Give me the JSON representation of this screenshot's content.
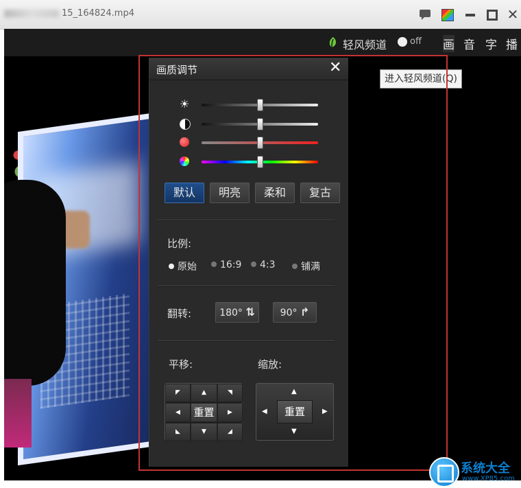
{
  "window": {
    "title": "15_164824.mp4"
  },
  "toolbar": {
    "channel_label": "轻风频道",
    "toggle_state": "off",
    "buttons": [
      "画",
      "音",
      "字",
      "播"
    ]
  },
  "tooltip": "进入轻风频道(Q)",
  "panel": {
    "title": "画质调节",
    "close_label": "✕",
    "sliders": [
      {
        "name": "brightness",
        "icon": "sun-icon",
        "level": 0.5
      },
      {
        "name": "contrast",
        "icon": "contrast-icon",
        "level": 0.5
      },
      {
        "name": "saturation",
        "icon": "red-dot-icon",
        "level": 0.5
      },
      {
        "name": "hue",
        "icon": "color-wheel-icon",
        "level": 0.5
      }
    ],
    "presets": [
      "默认",
      "明亮",
      "柔和",
      "复古"
    ],
    "active_preset": "默认",
    "ratio_label": "比例:",
    "ratio_options": [
      "原始",
      "16:9",
      "4:3",
      "铺满"
    ],
    "ratio_selected": "原始",
    "flip_label": "翻转:",
    "flip_buttons": [
      "180°",
      "90°"
    ],
    "pan_label": "平移:",
    "zoom_label": "缩放:",
    "pan_reset": "重置",
    "zoom_reset": "重置"
  },
  "watermark": {
    "text": "系统大全",
    "sub": "www.XP85.com"
  },
  "colors": {
    "highlight": "#c43333",
    "active_preset": "#1f4e8a",
    "panel_bg": "#2a2a2a"
  }
}
